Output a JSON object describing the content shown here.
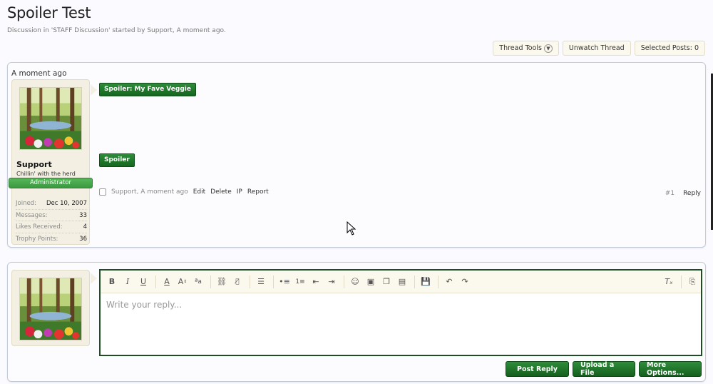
{
  "thread": {
    "title": "Spoiler Test",
    "subtitle": "Discussion in 'STAFF Discussion' started by Support, A moment ago."
  },
  "toolbar": {
    "thread_tools": "Thread Tools",
    "unwatch": "Unwatch Thread",
    "selected_posts": "Selected Posts: 0"
  },
  "post": {
    "date": "A moment ago",
    "user": {
      "name": "Support",
      "title": "Chillin' with the herd",
      "badge": "Administrator",
      "stats": [
        {
          "label": "Joined:",
          "value": "Dec 10, 2007"
        },
        {
          "label": "Messages:",
          "value": "33"
        },
        {
          "label": "Likes Received:",
          "value": "4"
        },
        {
          "label": "Trophy Points:",
          "value": "36"
        }
      ]
    },
    "spoilers": [
      "Spoiler: My Fave Veggie",
      "Spoiler"
    ],
    "meta": {
      "author_time": "Support, A moment ago",
      "edit": "Edit",
      "delete": "Delete",
      "ip": "IP",
      "report": "Report",
      "number": "#1",
      "reply": "Reply"
    }
  },
  "reply": {
    "placeholder": "Write your reply...",
    "post_reply": "Post Reply",
    "upload": "Upload a File",
    "more": "More Options..."
  },
  "colors": {
    "accent_green": "#15661f",
    "badge_green": "#3b9940",
    "panel_bg": "#f3f0e3"
  }
}
